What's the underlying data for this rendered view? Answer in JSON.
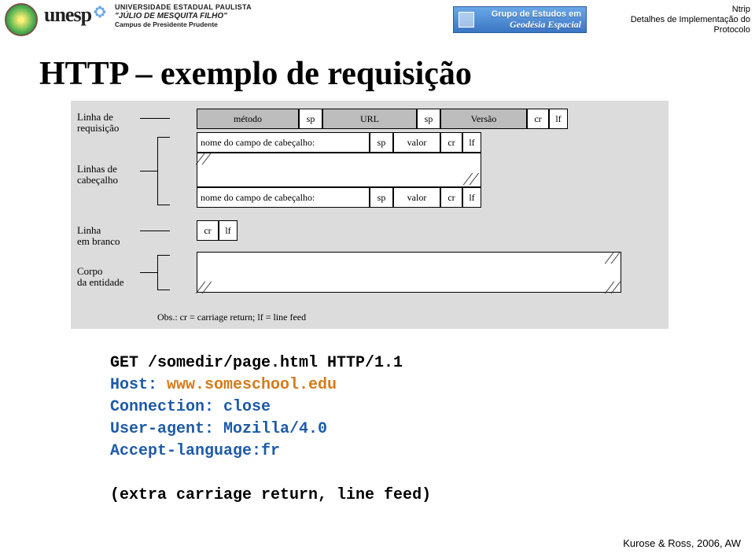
{
  "header": {
    "unesp": "unesp",
    "univ_line1": "UNIVERSIDADE ESTADUAL PAULISTA",
    "univ_line2": "\"JÚLIO DE MESQUITA FILHO\"",
    "univ_line3": "Campus de Presidente Prudente",
    "grupo_line1": "Grupo de Estudos em",
    "grupo_line2": "Geodésia Espacial",
    "meta_line1": "Ntrip",
    "meta_line2": "Detalhes de Implementação do Protocolo"
  },
  "title": "HTTP – exemplo de requisição",
  "diagram": {
    "labels": {
      "linha_req": "Linha de\nrequisição",
      "linhas_cab": "Linhas de\ncabeçalho",
      "linha_branco": "Linha\nem branco",
      "corpo": "Corpo\nda entidade"
    },
    "row1": {
      "metodo": "método",
      "sp": "sp",
      "url": "URL",
      "versao": "Versão",
      "cr": "cr",
      "lf": "lf"
    },
    "row2": {
      "campo": "nome do campo de cabeçalho:",
      "sp": "sp",
      "valor": "valor",
      "cr": "cr",
      "lf": "lf"
    },
    "row3": {
      "campo": "nome do campo de cabeçalho:",
      "sp": "sp",
      "valor": "valor",
      "cr": "cr",
      "lf": "lf"
    },
    "row4": {
      "cr": "cr",
      "lf": "lf"
    },
    "obs": "Obs.: cr = carriage return; lf = line feed"
  },
  "code": {
    "l1": "GET /somedir/page.html HTTP/1.1",
    "l2a": "Host: ",
    "l2b": "www.someschool.edu",
    "l3": "Connection: close",
    "l4": "User-agent: Mozilla/4.0",
    "l5": "Accept-language:fr",
    "l7": "(extra carriage return, line feed)"
  },
  "footer": "Kurose & Ross, 2006, AW"
}
